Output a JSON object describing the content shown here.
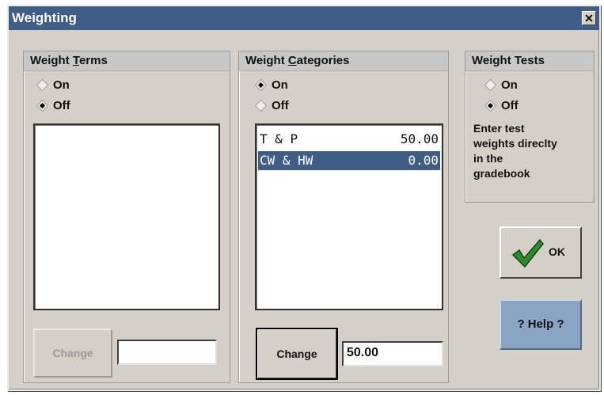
{
  "window": {
    "title": "Weighting",
    "close_glyph": "✕"
  },
  "weight_terms": {
    "title_pre": "Weight ",
    "title_mnemonic": "T",
    "title_post": "erms",
    "options": [
      {
        "label": "On",
        "checked": false
      },
      {
        "label": "Off",
        "checked": true
      }
    ],
    "change_label": "Change",
    "value": ""
  },
  "weight_categories": {
    "title_pre": "Weight ",
    "title_mnemonic": "C",
    "title_post": "ategories",
    "options": [
      {
        "label": "On",
        "checked": true
      },
      {
        "label": "Off",
        "checked": false
      }
    ],
    "items": [
      {
        "name": "T & P",
        "weight": "50.00",
        "selected": false
      },
      {
        "name": "CW & HW",
        "weight": "0.00",
        "selected": true
      }
    ],
    "change_label": "Change",
    "value": "50.00"
  },
  "weight_tests": {
    "title": "Weight Tests",
    "options": [
      {
        "label": "On",
        "checked": false
      },
      {
        "label": "Off",
        "checked": true
      }
    ],
    "note_lines": [
      "Enter test",
      "weights direclty",
      "in the",
      "gradebook"
    ]
  },
  "buttons": {
    "ok_label": "OK",
    "help_label": "? Help ?"
  },
  "colors": {
    "titlebar": "#3f5d85",
    "selection": "#3f5d85",
    "check_green": "#2e8b2e",
    "help_button": "#8aa5c4"
  },
  "icons": {
    "ok": "checkmark-icon",
    "close": "close-icon"
  }
}
